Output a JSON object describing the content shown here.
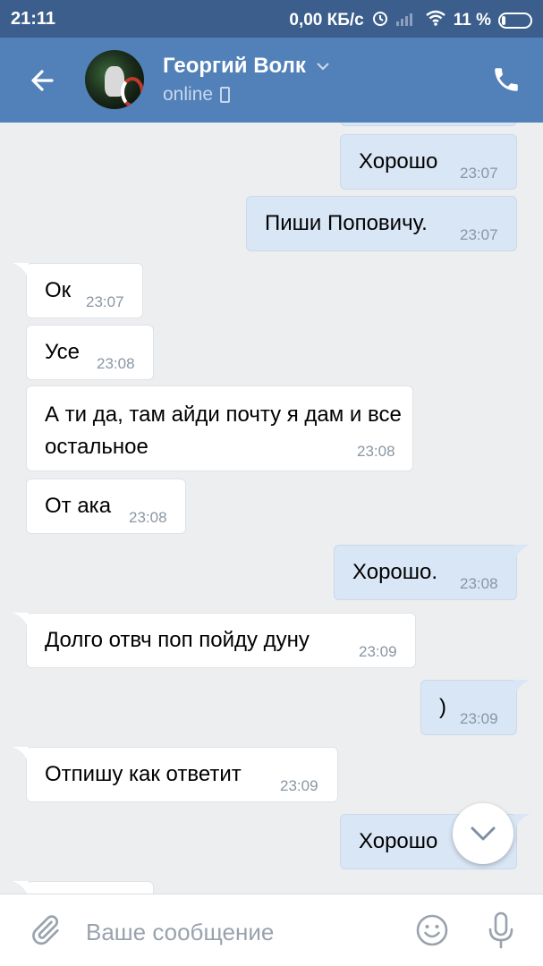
{
  "statusbar": {
    "time": "21:11",
    "network_speed": "0,00 КБ/с",
    "battery": "11 %"
  },
  "header": {
    "contact_name": "Георгий Волк",
    "status": "online"
  },
  "messages": [
    {
      "dir": "out",
      "text": "Хорошо",
      "time": "23:07"
    },
    {
      "dir": "out",
      "text": "Пиши Поповичу.",
      "time": "23:07"
    },
    {
      "dir": "in",
      "text": "Ок",
      "time": "23:07"
    },
    {
      "dir": "in",
      "text": "Усе",
      "time": "23:08"
    },
    {
      "dir": "in",
      "text": "А ти да, там айди почту я дам и все остальное",
      "time": "23:08"
    },
    {
      "dir": "in",
      "text": "От ака",
      "time": "23:08"
    },
    {
      "dir": "out",
      "text": "Хорошо.",
      "time": "23:08"
    },
    {
      "dir": "in",
      "text": "Долго отвч поп пойду дуну",
      "time": "23:09"
    },
    {
      "dir": "out",
      "text": ")",
      "time": "23:09"
    },
    {
      "dir": "in",
      "text": "Отпишу как ответит",
      "time": "23:09"
    },
    {
      "dir": "out",
      "text": "Хорошо",
      "time": ""
    }
  ],
  "input": {
    "placeholder": "Ваше сообщение"
  },
  "colors": {
    "header": "#5181b8",
    "statusbar": "#3b5e8c",
    "outgoing_bubble": "#d9e6f5",
    "incoming_bubble": "#ffffff",
    "background": "#edeef0"
  },
  "icons": {
    "back": "arrow-left-icon",
    "call": "phone-icon",
    "attach": "paperclip-icon",
    "emoji": "smiley-icon",
    "mic": "microphone-icon",
    "scroll": "chevron-down-icon"
  }
}
